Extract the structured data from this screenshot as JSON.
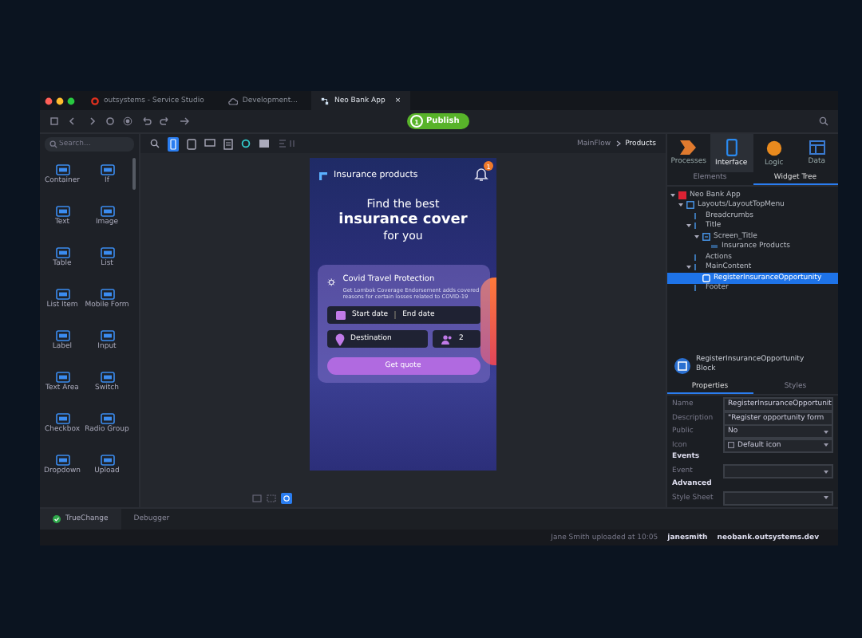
{
  "window_tabs": [
    {
      "label": "outsystems - Service Studio",
      "kind": "app",
      "selected": false
    },
    {
      "label": "Development...",
      "kind": "env",
      "selected": false
    },
    {
      "label": "Neo Bank App",
      "kind": "module",
      "selected": true,
      "close": "×"
    }
  ],
  "toolbar": {
    "publish_step": "1",
    "publish": "Publish"
  },
  "palette": {
    "search": {
      "placeholder": "Search..."
    },
    "widgets": [
      {
        "label": "Container"
      },
      {
        "label": "If"
      },
      {
        "label": "Text"
      },
      {
        "label": "Image"
      },
      {
        "label": "Table"
      },
      {
        "label": "List"
      },
      {
        "label": "List Item"
      },
      {
        "label": "Mobile Form"
      },
      {
        "label": "Label"
      },
      {
        "label": "Input"
      },
      {
        "label": "Text Area"
      },
      {
        "label": "Switch"
      },
      {
        "label": "Checkbox"
      },
      {
        "label": "Radio Group"
      },
      {
        "label": "Dropdown"
      },
      {
        "label": "Upload"
      }
    ]
  },
  "canvas": {
    "breadcrumb": [
      {
        "label": "MainFlow"
      },
      {
        "label": "Products"
      }
    ],
    "phone": {
      "title": "Insurance products",
      "notifications": "1",
      "heading": [
        "Find the best",
        "insurance cover",
        "for you"
      ],
      "card": {
        "title": "Covid Travel Protection",
        "text": "Get Lombok Coverage Endorsement adds covered reasons for certain losses related to COVID-19"
      },
      "start_date": "Start date",
      "end_date": "End date",
      "destination": "Destination",
      "travellers": "2",
      "button": "Get quote"
    }
  },
  "right_panel": {
    "tabs": [
      {
        "label": "Processes",
        "kind": "processes",
        "selected": false
      },
      {
        "label": "Interface",
        "kind": "interface",
        "selected": true
      },
      {
        "label": "Logic",
        "kind": "logic",
        "selected": false
      },
      {
        "label": "Data",
        "kind": "data",
        "selected": false
      }
    ],
    "subtabs": [
      {
        "label": "Elements",
        "selected": false
      },
      {
        "label": "Widget Tree",
        "selected": true
      }
    ],
    "tree": [
      {
        "label": "Neo Bank App",
        "kind": "app",
        "selected": false,
        "children": [
          {
            "label": "Layouts/LayoutTopMenu",
            "kind": "layout",
            "selected": false,
            "children": [
              {
                "label": "Breadcrumbs",
                "kind": "placeholder",
                "selected": false
              },
              {
                "label": "Title",
                "kind": "placeholder",
                "selected": false,
                "children": [
                  {
                    "label": "Screen_Title",
                    "kind": "widget",
                    "selected": false,
                    "children": [
                      {
                        "label": "Insurance Products",
                        "kind": "expression",
                        "selected": false
                      }
                    ]
                  }
                ]
              },
              {
                "label": "Actions",
                "kind": "placeholder",
                "selected": false
              },
              {
                "label": "MainContent",
                "kind": "placeholder",
                "selected": false,
                "children": [
                  {
                    "label": "RegisterInsuranceOpportunity",
                    "kind": "block",
                    "selected": true
                  }
                ]
              },
              {
                "label": "Footer",
                "kind": "placeholder",
                "selected": false
              }
            ]
          }
        ]
      }
    ],
    "block": {
      "name": "RegisterInsuranceOpportunity",
      "type": "Block"
    },
    "prop_tabs": [
      {
        "label": "Properties",
        "selected": true
      },
      {
        "label": "Styles",
        "selected": false
      }
    ],
    "properties": [
      {
        "kind": "field",
        "label": "Name",
        "value": "RegisterInsuranceOpportunit"
      },
      {
        "kind": "field",
        "label": "Description",
        "value": "\"Register opportunity form"
      },
      {
        "kind": "select",
        "label": "Public",
        "value": "No"
      },
      {
        "kind": "icon",
        "label": "Icon",
        "value": "Default icon"
      },
      {
        "kind": "heading",
        "label": "Events"
      },
      {
        "kind": "select",
        "label": "Event"
      },
      {
        "kind": "heading",
        "label": "Advanced"
      },
      {
        "kind": "select",
        "label": "Style Sheet"
      }
    ]
  },
  "bottom_tabs": [
    {
      "label": "TrueChange",
      "selected": true
    },
    {
      "label": "Debugger",
      "selected": false
    }
  ],
  "status": {
    "message": "Jane Smith uploaded at 10:05",
    "user": "janesmith",
    "server": "neobank.outsystems.dev"
  }
}
